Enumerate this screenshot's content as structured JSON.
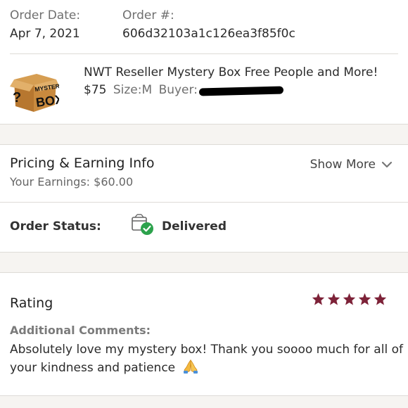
{
  "order": {
    "date_label": "Order Date:",
    "date_value": "Apr 7, 2021",
    "number_label": "Order #:",
    "number_value": "606d32103a1c126ea3f85f0c"
  },
  "product": {
    "image_text_top": "MYSTERY",
    "image_text_bottom": "BOX",
    "image_question": "?",
    "title": "NWT Reseller Mystery Box Free People and More!",
    "price": "$75",
    "size_label": "Size:",
    "size_value": "M",
    "buyer_label": "Buyer:"
  },
  "pricing": {
    "title": "Pricing & Earning Info",
    "earnings": "Your Earnings: $60.00",
    "show_more": "Show More",
    "show_more_icon": "chevron-down-icon"
  },
  "status": {
    "label": "Order Status:",
    "value": "Delivered",
    "icon": "delivered-box-check-icon",
    "check_color": "#2ca24c"
  },
  "rating": {
    "title": "Rating",
    "stars": 5,
    "star_color": "#7d2238",
    "comments_label": "Additional Comments:",
    "comments_text": "Absolutely love my mystery box! Thank you soooo much for all of your kindness and patience",
    "comments_emoji": "folded-hands-icon"
  }
}
